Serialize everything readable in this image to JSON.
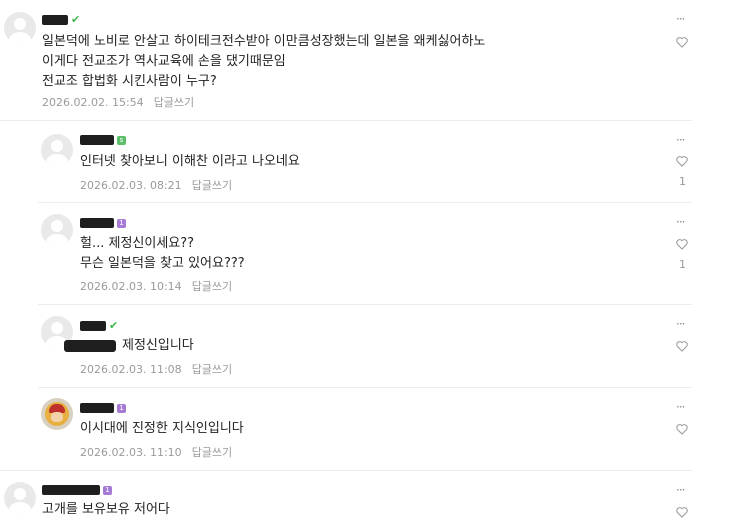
{
  "more_glyph": "···",
  "comments": [
    {
      "lines": [
        "일본덕에 노비로 안살고 하이테크전수받아 이만큼성장했는데 일본을 왜케싫어하노",
        "이게다 전교조가 역사교육에 손을 댔기때문임",
        "전교조 합법화 시킨사람이 누구?"
      ],
      "date": "2026.02.02. 15:54",
      "reply_label": "답글쓰기",
      "badge": "leaf"
    },
    {
      "lines": [
        "인터넷 찾아보니 이해찬 이라고 나오네요"
      ],
      "date": "2026.02.03. 08:21",
      "reply_label": "답글쓰기",
      "like_count": "1",
      "badge": "green"
    },
    {
      "lines": [
        "헐... 제정신이세요??",
        "무슨 일본덕을 찾고 있어요???"
      ],
      "date": "2026.02.03. 10:14",
      "reply_label": "답글쓰기",
      "like_count": "1",
      "badge": "purple"
    },
    {
      "lines": [
        "제정신입니다"
      ],
      "date": "2026.02.03. 11:08",
      "reply_label": "답글쓰기",
      "badge": "leaf"
    },
    {
      "lines": [
        "이시대에 진정한 지식인입니다"
      ],
      "date": "2026.02.03. 11:10",
      "reply_label": "답글쓰기",
      "badge": "purple"
    },
    {
      "lines": [
        "고개를 보유보유 저어다"
      ],
      "badge": "purple"
    }
  ]
}
